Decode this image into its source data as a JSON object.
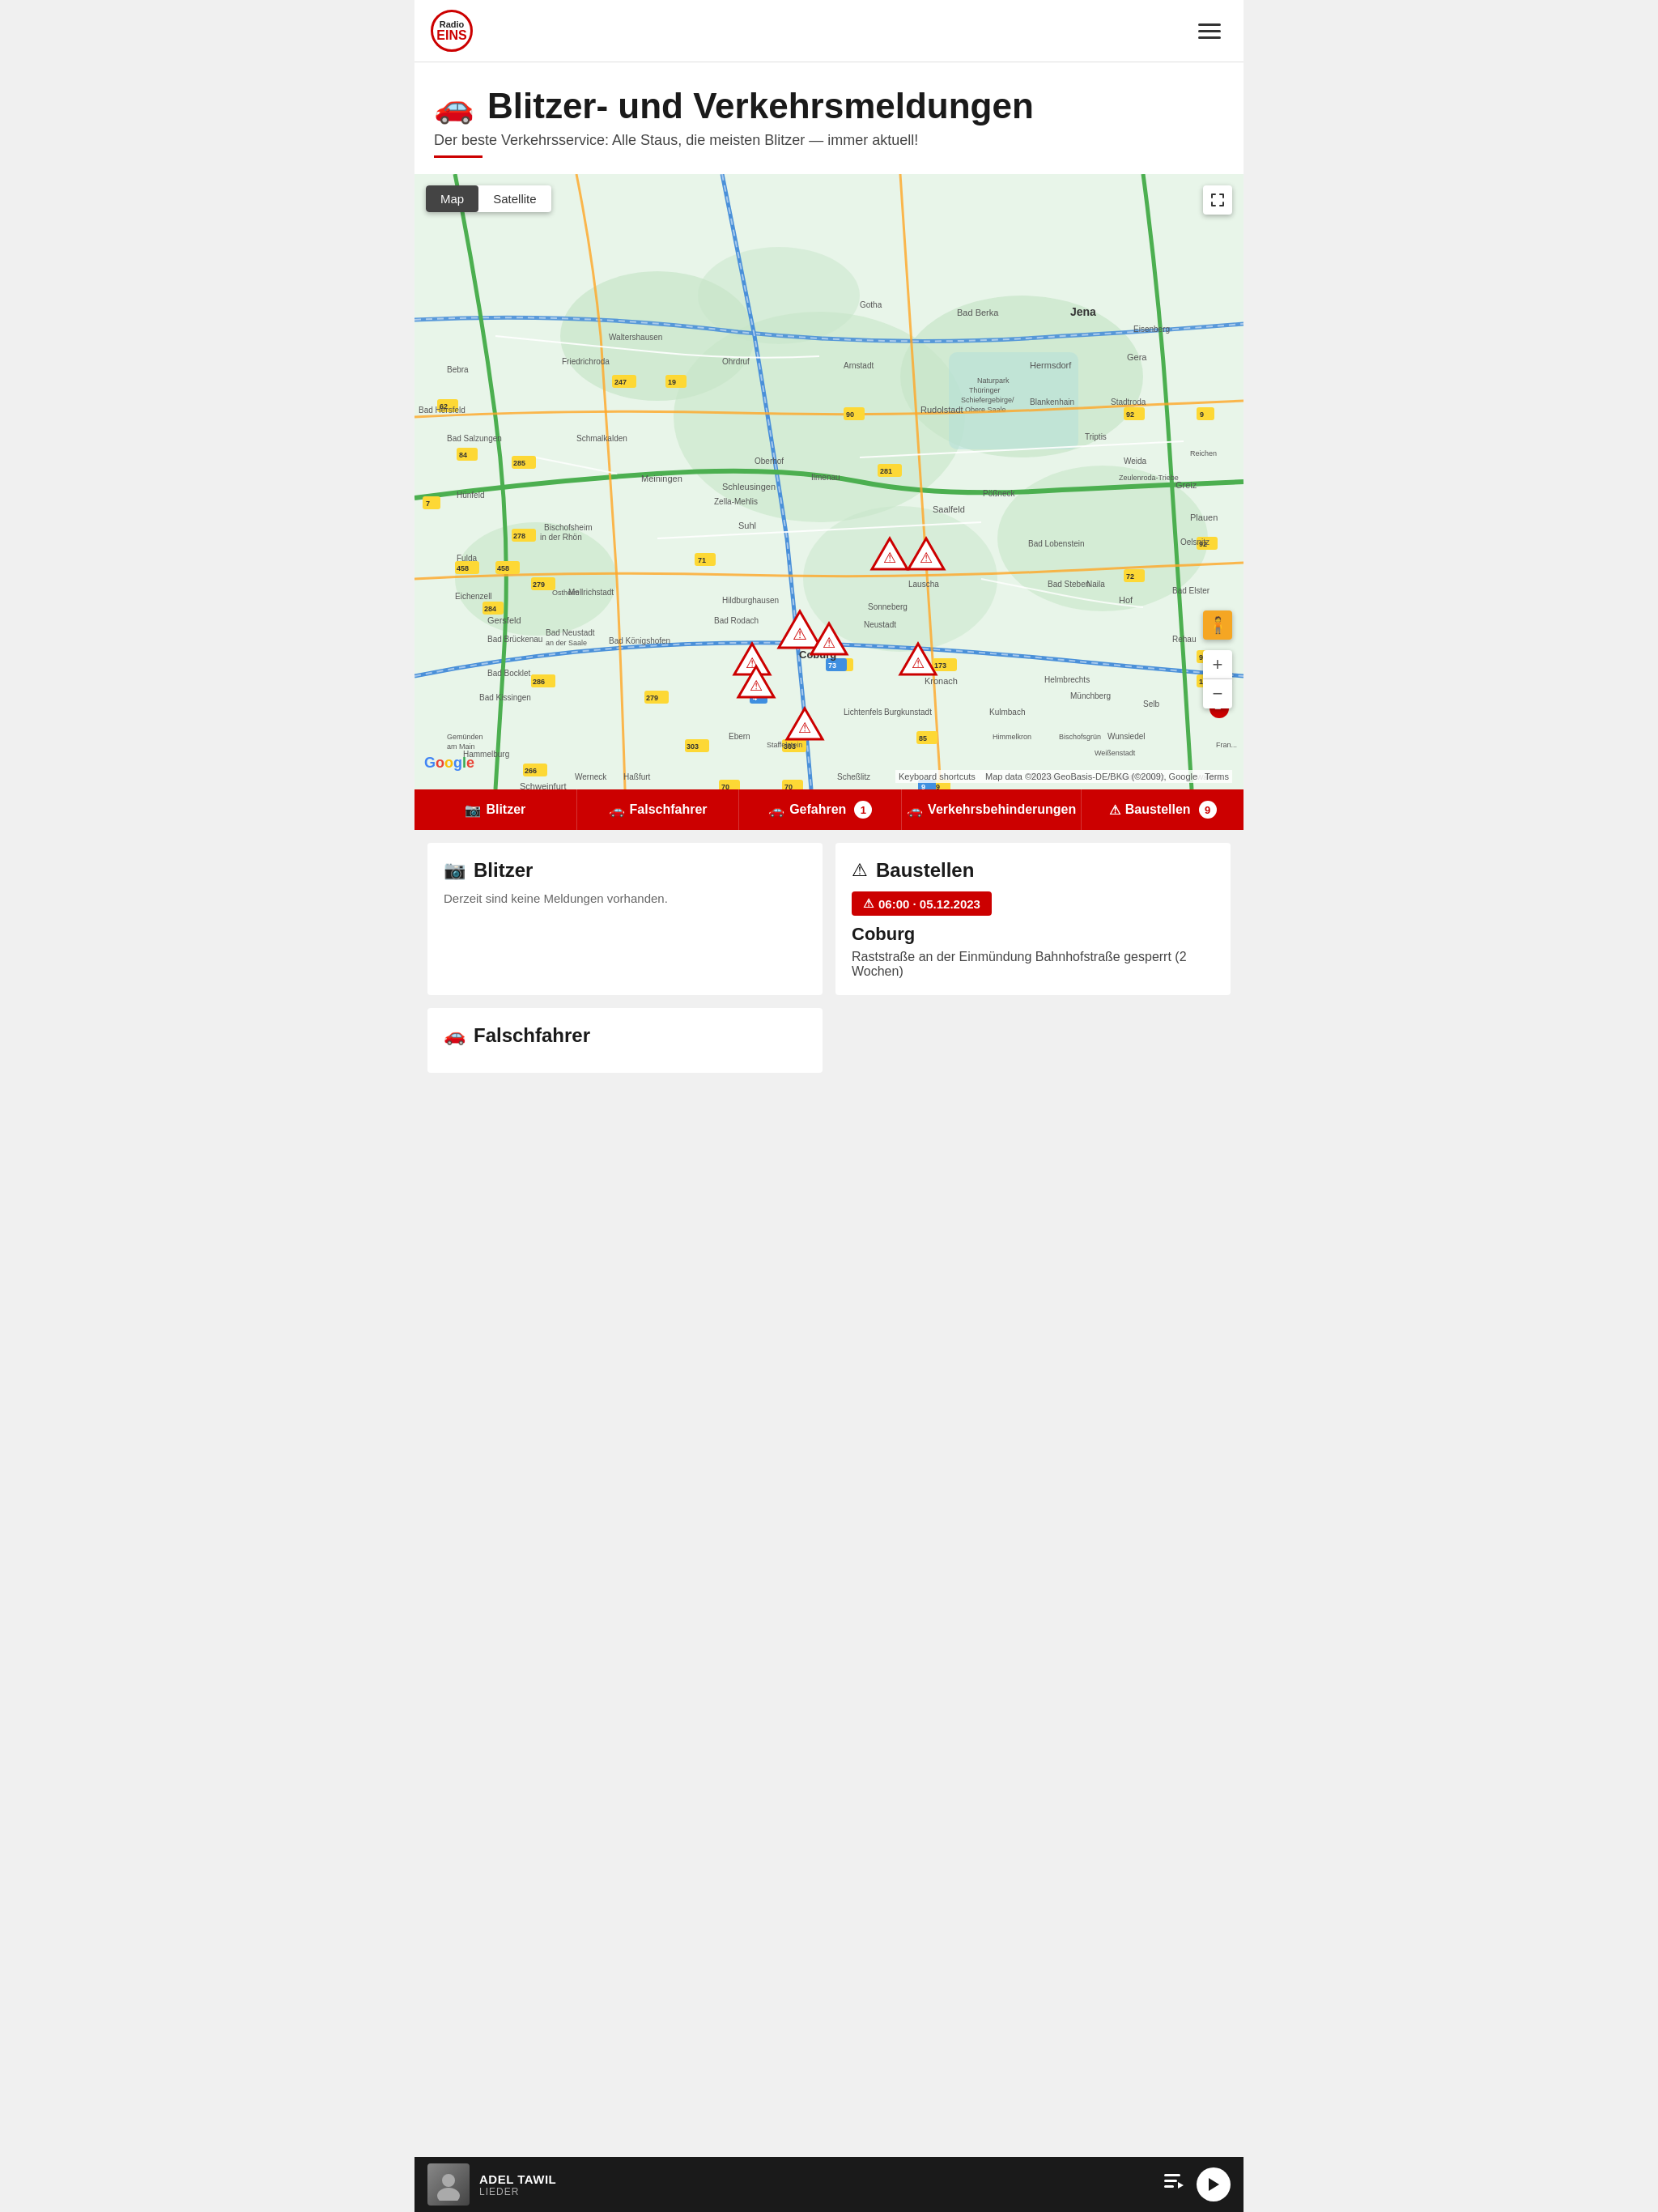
{
  "header": {
    "logo_radio": "Radio",
    "logo_eins": "EINS",
    "menu_label": "Menu"
  },
  "page": {
    "title_icon": "🚗",
    "title": "Blitzer- und Verkehrsmeldungen",
    "subtitle": "Der beste Verkehrsservice: Alle Staus, die meisten Blitzer — immer aktuell!"
  },
  "map": {
    "view_map": "Map",
    "view_satellite": "Satellite",
    "fullscreen_icon": "⛶",
    "keyboard_shortcuts": "Keyboard shortcuts",
    "map_data": "Map data ©2023 GeoBasis-DE/BKG (©2009), Google",
    "terms": "Terms"
  },
  "filter_buttons": [
    {
      "id": "blitzer",
      "icon": "📷",
      "label": "Blitzer",
      "badge": null
    },
    {
      "id": "falschfahrer",
      "icon": "🚗",
      "label": "Falschfahrer",
      "badge": null
    },
    {
      "id": "gefahren",
      "icon": "🚗",
      "label": "Gefahren",
      "badge": "1"
    },
    {
      "id": "verkehrsbehinderungen",
      "icon": "🚗",
      "label": "Verkehrsbehinderungen",
      "badge": null
    },
    {
      "id": "baustellen",
      "icon": "⚠",
      "label": "Baustellen",
      "badge": "9"
    }
  ],
  "cards": {
    "blitzer": {
      "title_icon": "📷",
      "title": "Blitzer",
      "empty_text": "Derzeit sind keine Meldungen vorhanden."
    },
    "baustellen": {
      "title_icon": "⚠",
      "title": "Baustellen",
      "badge_icon": "⚠",
      "badge_time": "06:00 · 05.12.2023",
      "location": "Coburg",
      "description": "Raststraße an der Einmündung Bahnhofstraße gesperrt (2 Wochen)"
    },
    "falschfahrer": {
      "title_icon": "🚗",
      "title": "Falschfahrer"
    }
  },
  "player": {
    "artist": "ADEL TAWIL",
    "type": "LIEDER",
    "playlist_icon": "≡",
    "play_icon": "▶"
  }
}
